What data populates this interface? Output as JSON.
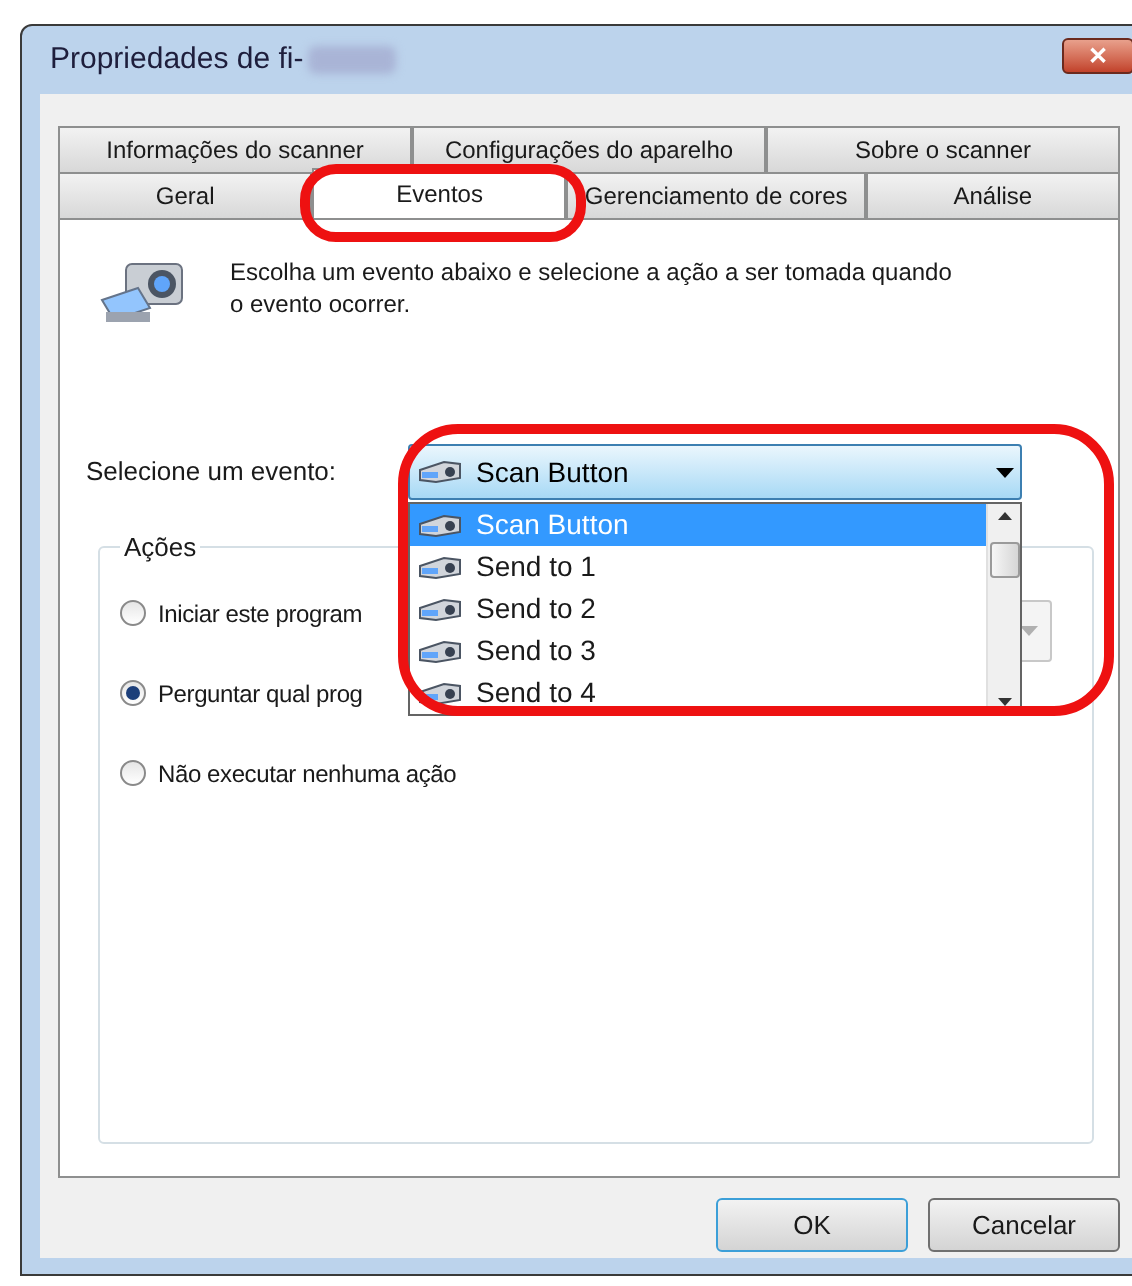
{
  "window": {
    "title": "Propriedades de fi-",
    "close": "✕"
  },
  "tab_rows": [
    [
      {
        "label": "Informações do scanner",
        "selected": false,
        "highlighted": false
      },
      {
        "label": "Configurações do aparelho",
        "selected": false,
        "highlighted": false
      },
      {
        "label": "Sobre o scanner",
        "selected": false,
        "highlighted": false
      }
    ],
    [
      {
        "label": "Geral",
        "selected": false,
        "highlighted": false
      },
      {
        "label": "Eventos",
        "selected": true,
        "highlighted": true
      },
      {
        "label": "Gerenciamento de cores",
        "selected": false,
        "highlighted": false
      },
      {
        "label": "Análise",
        "selected": false,
        "highlighted": false
      }
    ]
  ],
  "description": "Escolha um evento abaixo e selecione a ação a ser tomada quando o evento ocorrer.",
  "event_select": {
    "label": "Selecione um evento:",
    "value": "Scan Button",
    "expanded": true,
    "highlighted": true,
    "options": [
      {
        "label": "Scan Button",
        "selected": true
      },
      {
        "label": "Send to 1",
        "selected": false
      },
      {
        "label": "Send to 2",
        "selected": false
      },
      {
        "label": "Send to 3",
        "selected": false
      },
      {
        "label": "Send to 4",
        "selected": false
      }
    ]
  },
  "actions": {
    "title": "Ações",
    "options": [
      {
        "label": "Iniciar este program",
        "selected": false
      },
      {
        "label": "Perguntar qual prog",
        "selected": true
      },
      {
        "label": "Não executar nenhuma ação",
        "selected": false
      }
    ],
    "program_select": {
      "disabled": true
    }
  },
  "buttons": [
    {
      "label": "OK",
      "default": true
    },
    {
      "label": "Cancelar",
      "default": false
    }
  ]
}
